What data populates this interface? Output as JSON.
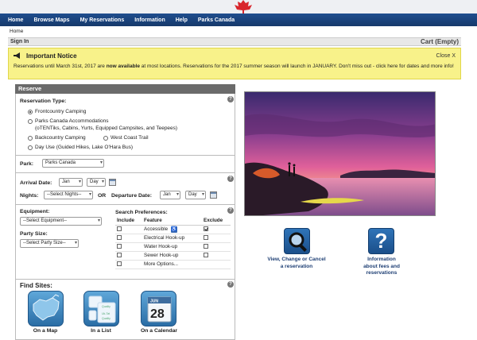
{
  "nav": {
    "items": [
      "Home",
      "Browse Maps",
      "My Reservations",
      "Information",
      "Help",
      "Parks Canada"
    ]
  },
  "breadcrumb": "Home",
  "signbar": {
    "sign_in": "Sign In",
    "cart": "Cart (Empty)"
  },
  "notice": {
    "title": "Important Notice",
    "close": "Close X",
    "text_a": "Reservations until March 31st, 2017 are ",
    "text_bold": "now available",
    "text_b": " at most locations. Reservations for the 2017 summer season will launch in JANUARY. Don't miss out - click here for dates and more info!"
  },
  "reserve": {
    "header": "Reserve",
    "type_label": "Reservation Type:",
    "types": [
      "Frontcountry Camping",
      "Parks Canada Accommodations",
      "(oTENTiks, Cabins, Yurts, Equipped Campsites, and Teepees)",
      "Backcountry Camping",
      "West Coast Trail",
      "Day Use (Guided Hikes, Lake O'Hara Bus)"
    ],
    "park_label": "Park:",
    "park_value": "Parks Canada",
    "arrival_label": "Arrival Date:",
    "arrival_month": "Jan",
    "arrival_day": "Day",
    "nights_label": "Nights:",
    "nights_value": "--Select Nights--",
    "or_label": "OR",
    "departure_label": "Departure Date:",
    "departure_month": "Jan",
    "departure_day": "Day",
    "equipment_label": "Equipment:",
    "equipment_value": "--Select Equipment--",
    "party_label": "Party Size:",
    "party_value": "--Select Party Size--",
    "prefs_label": "Search Preferences:",
    "prefs_headers": [
      "Include",
      "Feature",
      "Exclude"
    ],
    "prefs_rows": [
      "Accessible",
      "Electrical Hook-up",
      "Water Hook-up",
      "Sewer Hook-up",
      "More Options..."
    ],
    "help_glyph": "?"
  },
  "find": {
    "title": "Find Sites:",
    "on_map": "On a Map",
    "in_list": "In a List",
    "on_calendar": "On a Calendar",
    "calendar_month": "JUN",
    "calendar_day": "28",
    "list_words": [
      "Quality",
      "Uk-Tat",
      "Quality"
    ]
  },
  "actions": {
    "view_change": [
      "View, Change or Cancel",
      "a reservation"
    ],
    "info": [
      "Information",
      "about fees and",
      "reservations"
    ],
    "question_glyph": "?"
  },
  "colors": {
    "nav": "#1f4e8e",
    "notice_bg": "#f8f28a",
    "section_header": "#6b6b6b",
    "link": "#1e3f74"
  }
}
